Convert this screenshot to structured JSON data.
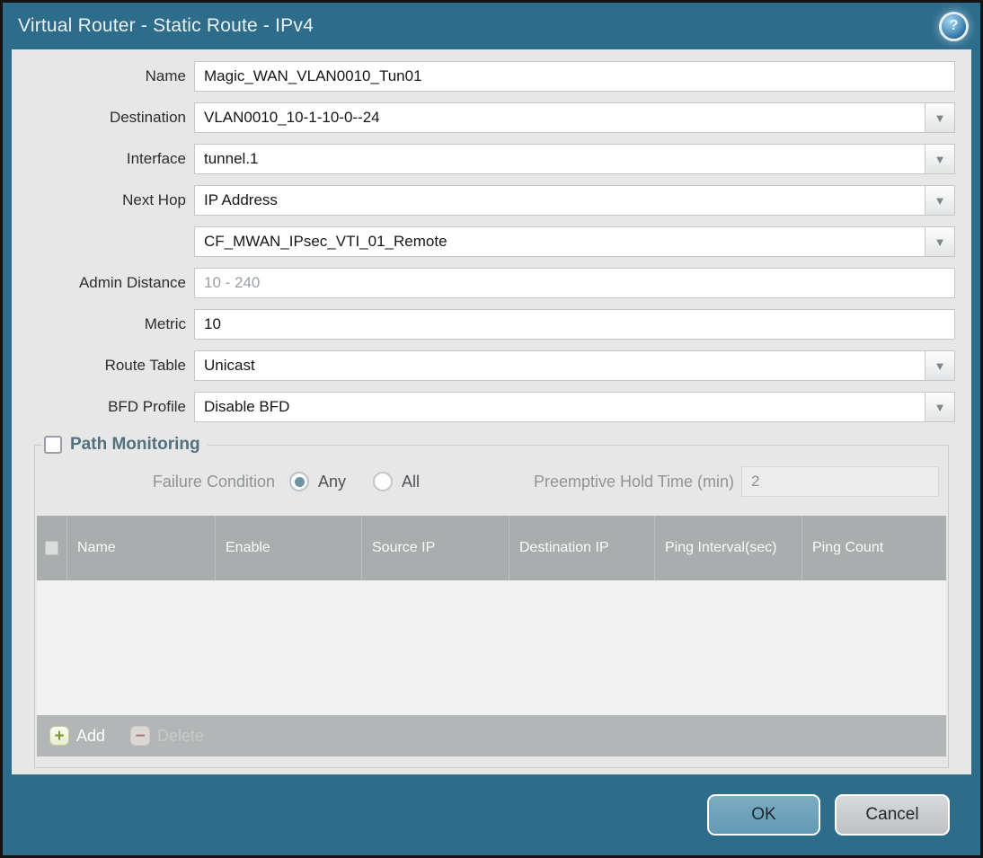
{
  "window": {
    "title": "Virtual Router - Static Route - IPv4"
  },
  "icons": {
    "help": "?",
    "dropdown": "▼",
    "add": "+",
    "delete": "−"
  },
  "form": {
    "rows": [
      {
        "label": "Name",
        "value": "Magic_WAN_VLAN0010_Tun01"
      },
      {
        "label": "Destination",
        "value": "VLAN0010_10-1-10-0--24"
      },
      {
        "label": "Interface",
        "value": "tunnel.1"
      },
      {
        "label": "Next Hop",
        "value": "IP Address"
      },
      {
        "label": "",
        "value": "CF_MWAN_IPsec_VTI_01_Remote"
      },
      {
        "label": "Admin Distance",
        "placeholder": "10 - 240"
      },
      {
        "label": "Metric",
        "value": "10"
      },
      {
        "label": "Route Table",
        "value": "Unicast"
      },
      {
        "label": "BFD Profile",
        "value": "Disable BFD"
      }
    ]
  },
  "path_monitoring": {
    "title": "Path Monitoring",
    "checked": false,
    "failure_condition_label": "Failure Condition",
    "options": [
      {
        "label": "Any",
        "selected": true
      },
      {
        "label": "All",
        "selected": false
      }
    ],
    "preemptive_label": "Preemptive Hold Time (min)",
    "preemptive_value": "2",
    "table": {
      "columns": [
        "Name",
        "Enable",
        "Source IP",
        "Destination IP",
        "Ping Interval(sec)",
        "Ping Count"
      ],
      "rows": []
    },
    "add_label": "Add",
    "delete_label": "Delete"
  },
  "footer": {
    "ok": "OK",
    "cancel": "Cancel"
  },
  "colors": {
    "chrome_teal": "#2e6c8b",
    "content_bg": "#e7e7e8",
    "section_title": "#52707e",
    "table_header_bg": "#a9adad",
    "table_footer_bg": "#b3b6b6",
    "ok_button": "#6ba1ba",
    "cancel_button": "#c9cbcd",
    "add_icon_green": "#7d9b2a",
    "delete_icon_red": "#b1756b",
    "radio_selected_dot": "#6d93a4"
  }
}
